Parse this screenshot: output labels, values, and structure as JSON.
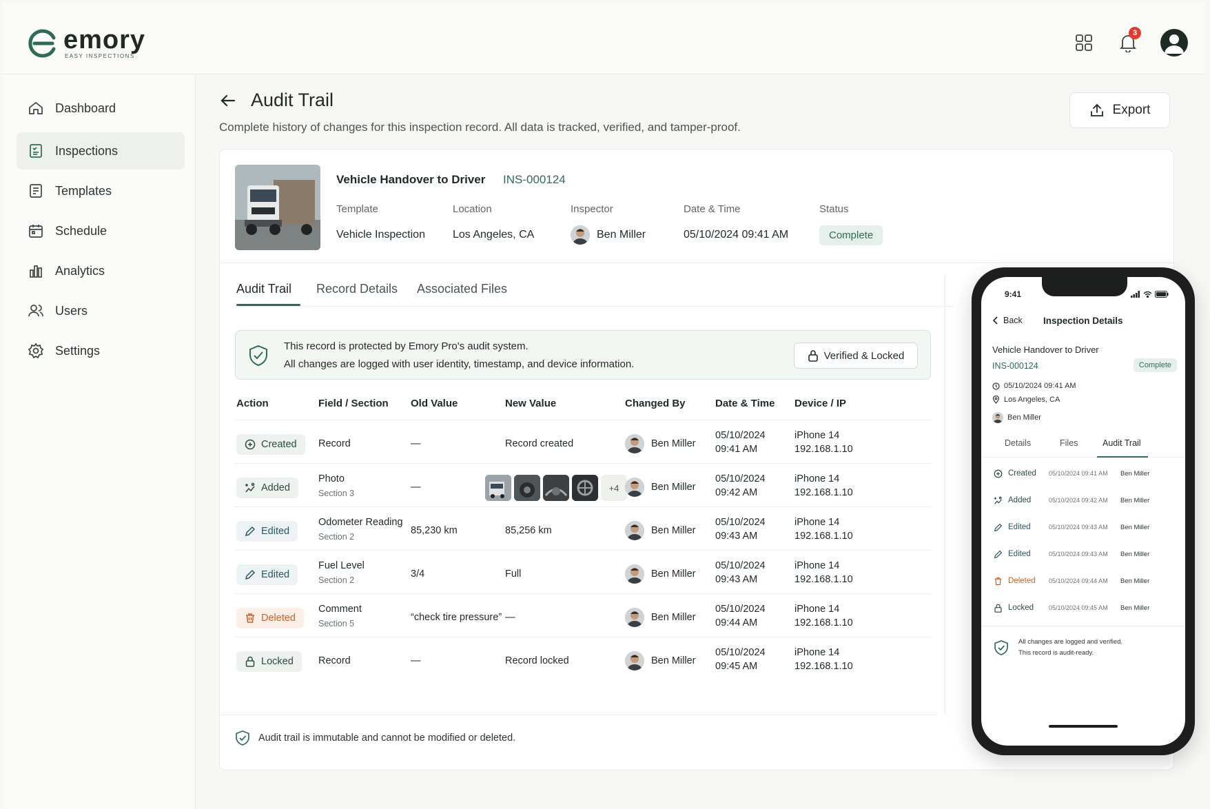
{
  "brand": {
    "name": "emory",
    "tagline": "EASY INSPECTIONS"
  },
  "header": {
    "notifications_count": "3"
  },
  "sidebar": {
    "items": [
      {
        "label": "Dashboard",
        "icon": "home-icon"
      },
      {
        "label": "Inspections",
        "icon": "clipboard-icon",
        "active": true
      },
      {
        "label": "Templates",
        "icon": "template-icon"
      },
      {
        "label": "Schedule",
        "icon": "calendar-icon"
      },
      {
        "label": "Analytics",
        "icon": "chart-icon"
      },
      {
        "label": "Users",
        "icon": "users-icon"
      },
      {
        "label": "Settings",
        "icon": "gear-icon"
      }
    ]
  },
  "page": {
    "title": "Audit Trail",
    "subtitle": "Complete history of changes for this inspection record. All data is tracked, verified, and tamper-proof.",
    "export_label": "Export"
  },
  "record": {
    "title": "Vehicle Handover to Driver",
    "id": "INS-000124",
    "template_label": "Template",
    "template": "Vehicle Inspection",
    "location_label": "Location",
    "location": "Los Angeles, CA",
    "inspector_label": "Inspector",
    "inspector": "Ben Miller",
    "datetime_label": "Date & Time",
    "datetime": "05/10/2024 09:41 AM",
    "status_label": "Status",
    "status": "Complete"
  },
  "tabs": [
    "Audit Trail",
    "Record Details",
    "Associated Files"
  ],
  "notice": {
    "line1": "This record is protected by Emory Pro's audit system.",
    "line2": "All changes are logged with user identity, timestamp, and device information.",
    "button": "Verified & Locked"
  },
  "table": {
    "headers": [
      "Action",
      "Field / Section",
      "Old Value",
      "New Value",
      "Changed By",
      "Date & Time",
      "Device / IP"
    ],
    "rows": [
      {
        "action": "Created",
        "field": "Record",
        "section": "",
        "old": "—",
        "new": "Record created",
        "by": "Ben Miller",
        "date": "05/10/2024",
        "time": "09:41 AM",
        "device": "iPhone 14",
        "ip": "192.168.1.10"
      },
      {
        "action": "Added",
        "field": "Photo",
        "section": "Section 3",
        "old": "—",
        "new": "",
        "by": "Ben Miller",
        "date": "05/10/2024",
        "time": "09:42 AM",
        "device": "iPhone 14",
        "ip": "192.168.1.10",
        "more_photos": "+4"
      },
      {
        "action": "Edited",
        "field": "Odometer Reading",
        "section": "Section 2",
        "old": "85,230 km",
        "new": "85,256 km",
        "by": "Ben Miller",
        "date": "05/10/2024",
        "time": "09:43 AM",
        "device": "iPhone 14",
        "ip": "192.168.1.10"
      },
      {
        "action": "Edited",
        "field": "Fuel Level",
        "section": "Section 2",
        "old": "3/4",
        "new": "Full",
        "by": "Ben Miller",
        "date": "05/10/2024",
        "time": "09:43 AM",
        "device": "iPhone 14",
        "ip": "192.168.1.10"
      },
      {
        "action": "Deleted",
        "field": "Comment",
        "section": "Section 5",
        "old": "“check tire pressure”",
        "new": "—",
        "by": "Ben Miller",
        "date": "05/10/2024",
        "time": "09:44 AM",
        "device": "iPhone 14",
        "ip": "192.168.1.10"
      },
      {
        "action": "Locked",
        "field": "Record",
        "section": "",
        "old": "—",
        "new": "Record locked",
        "by": "Ben Miller",
        "date": "05/10/2024",
        "time": "09:45 AM",
        "device": "iPhone 14",
        "ip": "192.168.1.10"
      }
    ]
  },
  "footer_note": "Audit trail is immutable and cannot be modified or deleted.",
  "phone": {
    "time": "9:41",
    "back": "Back",
    "title": "Inspection Details",
    "record_title": "Vehicle Handover to Driver",
    "record_id": "INS-000124",
    "status": "Complete",
    "datetime": "05/10/2024 09:41 AM",
    "location": "Los Angeles, CA",
    "inspector": "Ben Miller",
    "tabs": [
      "Details",
      "Files",
      "Audit Trail"
    ],
    "rows": [
      {
        "action": "Created",
        "dt": "05/10/2024 09:41 AM",
        "by": "Ben Miller"
      },
      {
        "action": "Added",
        "dt": "05/10/2024 09:42 AM",
        "by": "Ben Miller"
      },
      {
        "action": "Edited",
        "dt": "05/10/2024 09:43 AM",
        "by": "Ben Miller"
      },
      {
        "action": "Edited",
        "dt": "05/10/2024 09:43 AM",
        "by": "Ben Miller"
      },
      {
        "action": "Deleted",
        "dt": "05/10/2024 09:44 AM",
        "by": "Ben Miller"
      },
      {
        "action": "Locked",
        "dt": "05/10/2024 09:45 AM",
        "by": "Ben Miller"
      }
    ],
    "footer_line1": "All changes are logged and verified.",
    "footer_line2": "This record is audit-ready."
  },
  "colors": {
    "accent": "#2f6b55",
    "deleted": "#c4642c",
    "badge": "#e23b2e"
  }
}
